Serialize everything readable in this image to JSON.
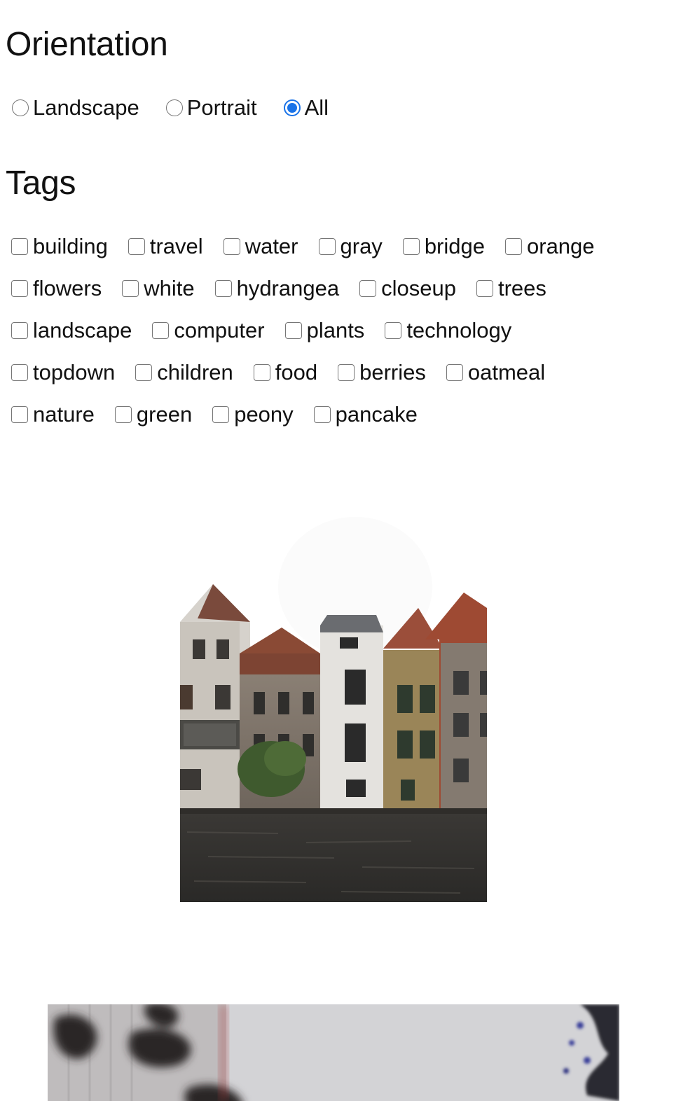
{
  "orientation": {
    "heading": "Orientation",
    "options": [
      {
        "label": "Landscape",
        "checked": false
      },
      {
        "label": "Portrait",
        "checked": false
      },
      {
        "label": "All",
        "checked": true
      }
    ]
  },
  "tags": {
    "heading": "Tags",
    "rows": [
      [
        "building",
        "travel",
        "water",
        "gray",
        "bridge",
        "orange"
      ],
      [
        "flowers",
        "white",
        "hydrangea",
        "closeup",
        "trees"
      ],
      [
        "landscape",
        "computer",
        "plants",
        "technology"
      ],
      [
        "topdown",
        "children",
        "food",
        "berries",
        "oatmeal"
      ],
      [
        "nature",
        "green",
        "peony",
        "pancake"
      ]
    ]
  },
  "gallery": {
    "items": [
      {
        "subject": "canal-houses-photo"
      },
      {
        "subject": "blurred-foliage-photo"
      }
    ]
  },
  "colors": {
    "accent": "#1a73e8",
    "control_border": "#767676"
  }
}
